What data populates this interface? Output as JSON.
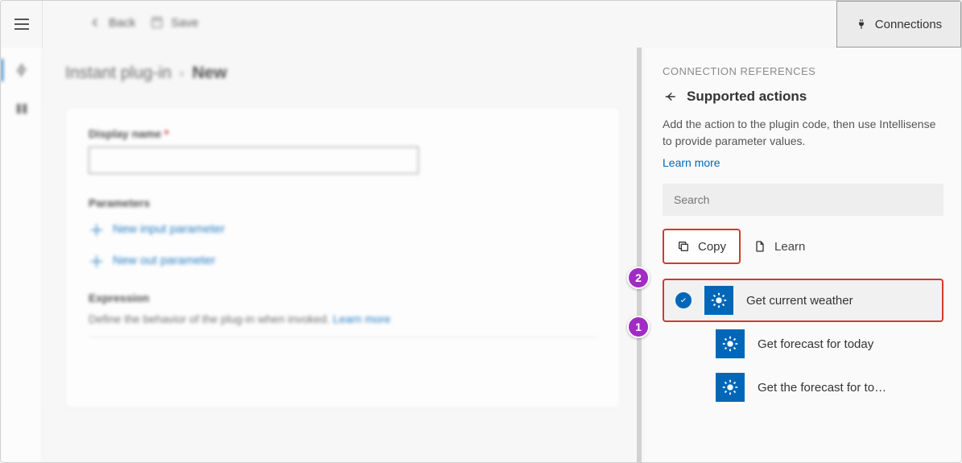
{
  "topbar": {
    "back": "Back",
    "save": "Save",
    "connections": "Connections"
  },
  "breadcrumb": {
    "parent": "Instant plug-in",
    "current": "New"
  },
  "form": {
    "display_name_label": "Display name",
    "display_name_value": "",
    "parameters_label": "Parameters",
    "new_input": "New input parameter",
    "new_out": "New out parameter",
    "expression_label": "Expression",
    "expression_desc": "Define the behavior of the plug-in when invoked.",
    "expression_learn": "Learn more"
  },
  "panel": {
    "eyebrow": "CONNECTION REFERENCES",
    "title": "Supported actions",
    "desc": "Add the action to the plugin code, then use Intellisense to provide parameter values.",
    "learn": "Learn more",
    "search_placeholder": "Search",
    "copy": "Copy",
    "learn_link": "Learn",
    "actions": [
      {
        "label": "Get current weather",
        "selected": true
      },
      {
        "label": "Get forecast for today",
        "selected": false
      },
      {
        "label": "Get the forecast for to…",
        "selected": false
      }
    ]
  },
  "callouts": {
    "c1": "1",
    "c2": "2"
  }
}
